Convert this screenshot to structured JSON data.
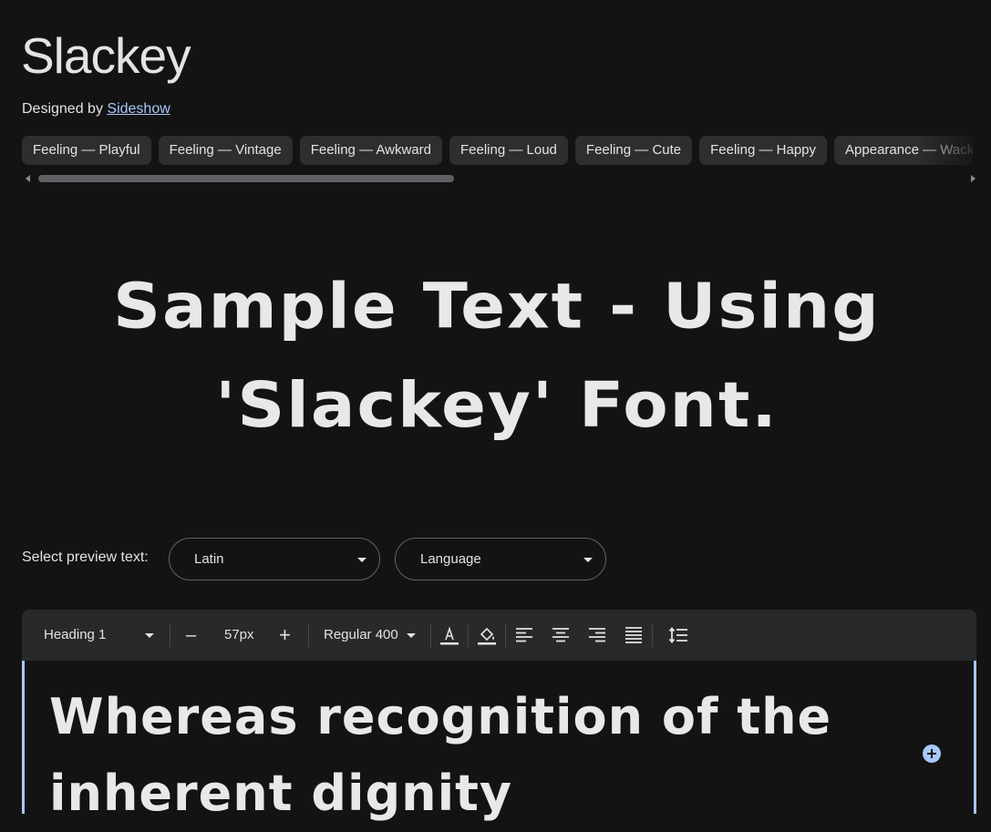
{
  "font": {
    "name": "Slackey",
    "designed_by_label": "Designed by",
    "designer": "Sideshow"
  },
  "tags": [
    "Feeling — Playful",
    "Feeling — Vintage",
    "Feeling — Awkward",
    "Feeling — Loud",
    "Feeling — Cute",
    "Feeling — Happy",
    "Appearance — Wacky"
  ],
  "sample_text": "Sample Text - Using 'Slackey' Font.",
  "preview": {
    "label": "Select preview text:",
    "script_value": "Latin",
    "language_value": "Language"
  },
  "toolbar": {
    "style_value": "Heading 1",
    "size_value": "57px",
    "decrement": "–",
    "increment": "+",
    "weight_value": "Regular 400"
  },
  "editor": {
    "text": "Whereas recognition of the inherent dignity"
  },
  "colors": {
    "background": "#131314",
    "link": "#a8c7fa",
    "chip": "#2d2e30",
    "toolbar": "#28292b",
    "focus_border": "#a8c7fa"
  },
  "icons": [
    "text-color-icon",
    "highlight-color-icon",
    "align-left-icon",
    "align-center-icon",
    "align-right-icon",
    "align-justify-icon",
    "line-height-icon",
    "add-circle-icon"
  ]
}
